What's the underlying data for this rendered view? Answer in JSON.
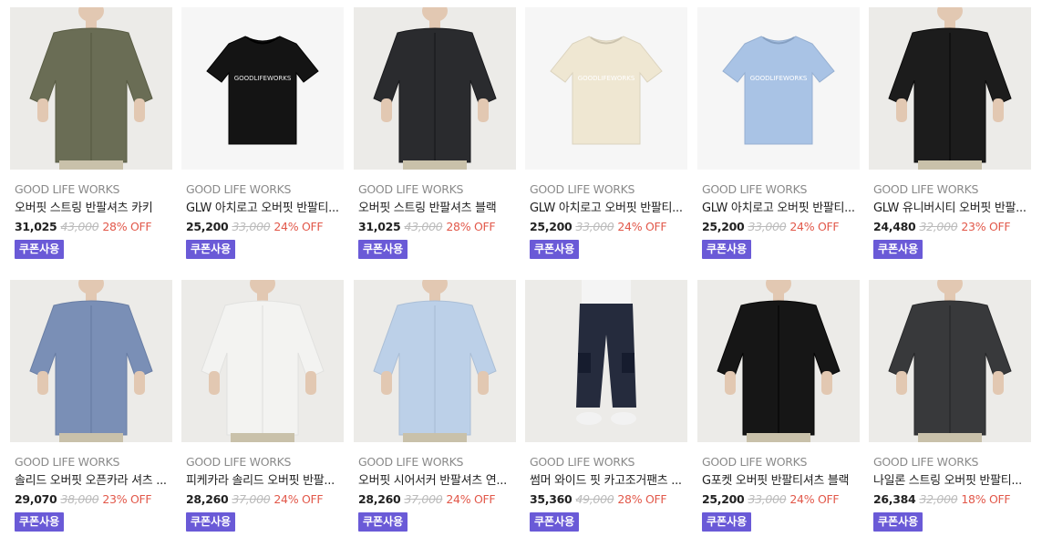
{
  "products": [
    {
      "brand": "GOOD LIFE WORKS",
      "name": "오버핏 스트링 반팔셔츠 카키",
      "price": "31,025",
      "original": "43,000",
      "discount": "28% OFF",
      "coupon": "쿠폰사용",
      "image": "khaki-shirt-model",
      "color": "#6a6d55"
    },
    {
      "brand": "GOOD LIFE WORKS",
      "name": "GLW 아치로고 오버핏 반팔티...",
      "price": "25,200",
      "original": "33,000",
      "discount": "24% OFF",
      "coupon": "쿠폰사용",
      "image": "black-logo-tee",
      "color": "#141414"
    },
    {
      "brand": "GOOD LIFE WORKS",
      "name": "오버핏 스트링 반팔셔츠 블랙",
      "price": "31,025",
      "original": "43,000",
      "discount": "28% OFF",
      "coupon": "쿠폰사용",
      "image": "black-shirt-model",
      "color": "#2a2b2e"
    },
    {
      "brand": "GOOD LIFE WORKS",
      "name": "GLW 아치로고 오버핏 반팔티...",
      "price": "25,200",
      "original": "33,000",
      "discount": "24% OFF",
      "coupon": "쿠폰사용",
      "image": "cream-logo-tee",
      "color": "#efe7d2"
    },
    {
      "brand": "GOOD LIFE WORKS",
      "name": "GLW 아치로고 오버핏 반팔티...",
      "price": "25,200",
      "original": "33,000",
      "discount": "24% OFF",
      "coupon": "쿠폰사용",
      "image": "skyblue-logo-tee",
      "color": "#a9c3e5"
    },
    {
      "brand": "GOOD LIFE WORKS",
      "name": "GLW 유니버시티 오버핏 반팔...",
      "price": "24,480",
      "original": "32,000",
      "discount": "23% OFF",
      "coupon": "쿠폰사용",
      "image": "black-university-tee-model",
      "color": "#1c1c1c"
    },
    {
      "brand": "GOOD LIFE WORKS",
      "name": "솔리드 오버핏 오픈카라 셔츠 ...",
      "price": "29,070",
      "original": "38,000",
      "discount": "23% OFF",
      "coupon": "쿠폰사용",
      "image": "blue-open-collar-shirt-model",
      "color": "#7a8fb6"
    },
    {
      "brand": "GOOD LIFE WORKS",
      "name": "피케카라 솔리드 오버핏 반팔...",
      "price": "28,260",
      "original": "37,000",
      "discount": "24% OFF",
      "coupon": "쿠폰사용",
      "image": "white-pique-polo-model",
      "color": "#f3f3f1"
    },
    {
      "brand": "GOOD LIFE WORKS",
      "name": "오버핏 시어서커 반팔셔츠 연...",
      "price": "28,260",
      "original": "37,000",
      "discount": "24% OFF",
      "coupon": "쿠폰사용",
      "image": "lightblue-seersucker-shirt-model",
      "color": "#bcd0e8"
    },
    {
      "brand": "GOOD LIFE WORKS",
      "name": "썸머 와이드 핏 카고조거팬츠 ...",
      "price": "35,360",
      "original": "49,000",
      "discount": "28% OFF",
      "coupon": "쿠폰사용",
      "image": "navy-cargo-jogger-model",
      "color": "#252b3d"
    },
    {
      "brand": "GOOD LIFE WORKS",
      "name": "G포켓 오버핏 반팔티셔츠 블랙",
      "price": "25,200",
      "original": "33,000",
      "discount": "24% OFF",
      "coupon": "쿠폰사용",
      "image": "black-pocket-tee-model",
      "color": "#161616"
    },
    {
      "brand": "GOOD LIFE WORKS",
      "name": "나일론 스트링 오버핏 반팔티...",
      "price": "26,384",
      "original": "32,000",
      "discount": "18% OFF",
      "coupon": "쿠폰사용",
      "image": "charcoal-nylon-tee-model",
      "color": "#38393b"
    }
  ]
}
